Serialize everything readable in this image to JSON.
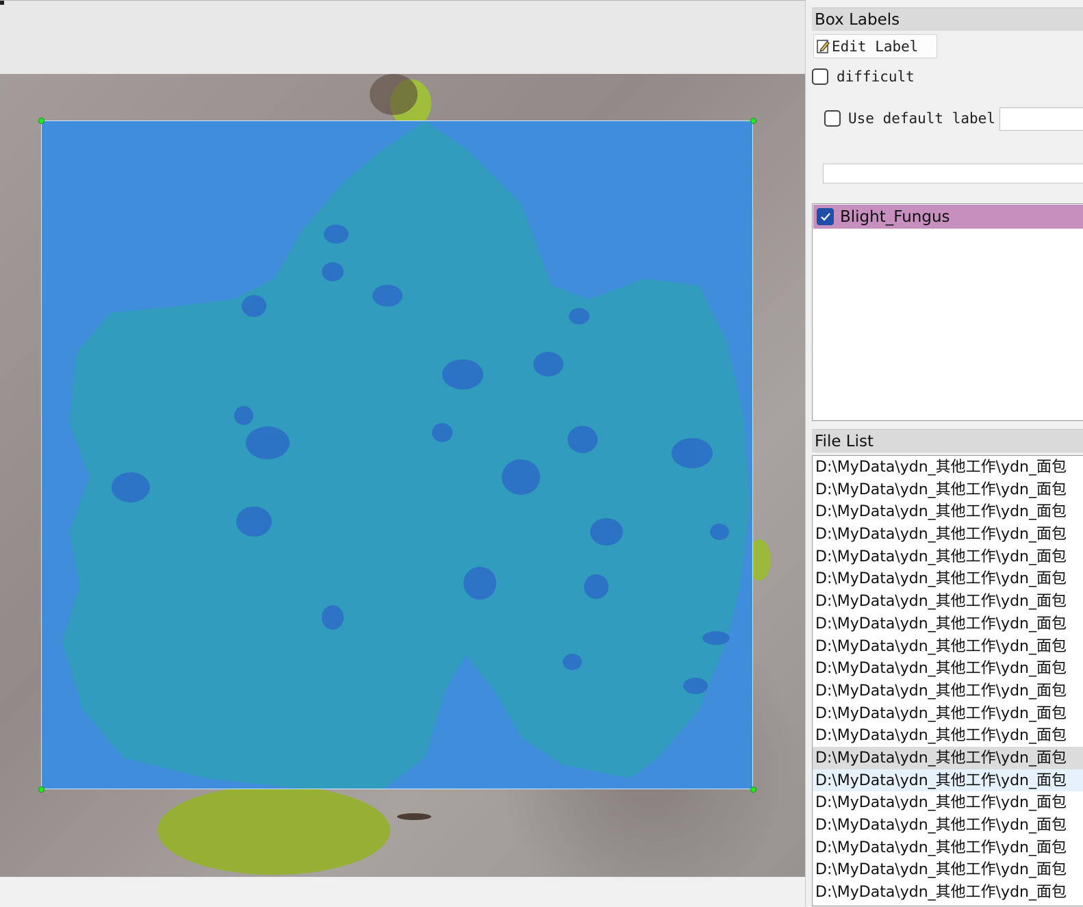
{
  "dock": {
    "box_labels_title": "Box Labels",
    "edit_label_button": "Edit Label",
    "difficult_label": "difficult",
    "use_default_label": "Use default label",
    "default_label_value": "",
    "label_items": [
      {
        "text": "Blight_Fungus",
        "checked": true,
        "color": "#c68fbe"
      }
    ],
    "file_list_title": "File List",
    "file_rows": [
      "D:\\MyData\\ydn_其他工作\\ydn_面包",
      "D:\\MyData\\ydn_其他工作\\ydn_面包",
      "D:\\MyData\\ydn_其他工作\\ydn_面包",
      "D:\\MyData\\ydn_其他工作\\ydn_面包",
      "D:\\MyData\\ydn_其他工作\\ydn_面包",
      "D:\\MyData\\ydn_其他工作\\ydn_面包",
      "D:\\MyData\\ydn_其他工作\\ydn_面包",
      "D:\\MyData\\ydn_其他工作\\ydn_面包",
      "D:\\MyData\\ydn_其他工作\\ydn_面包",
      "D:\\MyData\\ydn_其他工作\\ydn_面包",
      "D:\\MyData\\ydn_其他工作\\ydn_面包",
      "D:\\MyData\\ydn_其他工作\\ydn_面包",
      "D:\\MyData\\ydn_其他工作\\ydn_面包",
      "D:\\MyData\\ydn_其他工作\\ydn_面包",
      "D:\\MyData\\ydn_其他工作\\ydn_面包",
      "D:\\MyData\\ydn_其他工作\\ydn_面包",
      "D:\\MyData\\ydn_其他工作\\ydn_面包",
      "D:\\MyData\\ydn_其他工作\\ydn_面包",
      "D:\\MyData\\ydn_其他工作\\ydn_面包",
      "D:\\MyData\\ydn_其他工作\\ydn_面包"
    ],
    "selected_file_index": 14,
    "hover_file_index": 15
  },
  "canvas": {
    "bbox_fill_color": "#3f8ddb",
    "handle_color": "#23e823"
  }
}
